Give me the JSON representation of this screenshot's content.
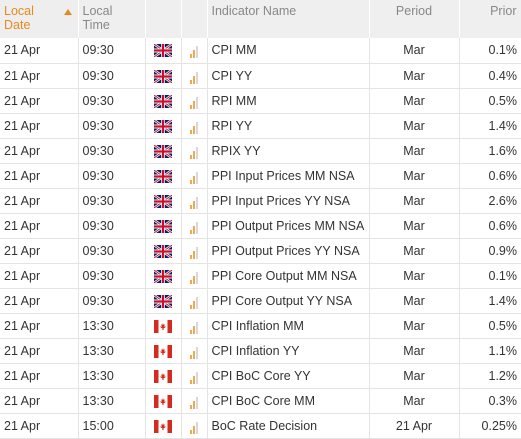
{
  "header": {
    "date": [
      "Local",
      "Date"
    ],
    "time": [
      "Local",
      "Time"
    ],
    "indicator": "Indicator Name",
    "period": "Period",
    "prior": "Prior"
  },
  "colors": {
    "accent": "#e8891d",
    "bar_active": "#f0a94e",
    "bar_inactive": "#d8d8d8"
  },
  "rows": [
    {
      "date": "21 Apr",
      "time": "09:30",
      "flag": "uk-flag",
      "importance": 2,
      "name": "CPI MM",
      "period": "Mar",
      "prior": "0.1%"
    },
    {
      "date": "21 Apr",
      "time": "09:30",
      "flag": "uk-flag",
      "importance": 2,
      "name": "CPI YY",
      "period": "Mar",
      "prior": "0.4%"
    },
    {
      "date": "21 Apr",
      "time": "09:30",
      "flag": "uk-flag",
      "importance": 2,
      "name": "RPI MM",
      "period": "Mar",
      "prior": "0.5%"
    },
    {
      "date": "21 Apr",
      "time": "09:30",
      "flag": "uk-flag",
      "importance": 2,
      "name": "RPI YY",
      "period": "Mar",
      "prior": "1.4%"
    },
    {
      "date": "21 Apr",
      "time": "09:30",
      "flag": "uk-flag",
      "importance": 2,
      "name": "RPIX YY",
      "period": "Mar",
      "prior": "1.6%"
    },
    {
      "date": "21 Apr",
      "time": "09:30",
      "flag": "uk-flag",
      "importance": 2,
      "name": "PPI Input Prices MM NSA",
      "period": "Mar",
      "prior": "0.6%"
    },
    {
      "date": "21 Apr",
      "time": "09:30",
      "flag": "uk-flag",
      "importance": 2,
      "name": "PPI Input Prices YY NSA",
      "period": "Mar",
      "prior": "2.6%"
    },
    {
      "date": "21 Apr",
      "time": "09:30",
      "flag": "uk-flag",
      "importance": 2,
      "name": "PPI Output Prices MM NSA",
      "period": "Mar",
      "prior": "0.6%"
    },
    {
      "date": "21 Apr",
      "time": "09:30",
      "flag": "uk-flag",
      "importance": 2,
      "name": "PPI Output Prices YY NSA",
      "period": "Mar",
      "prior": "0.9%"
    },
    {
      "date": "21 Apr",
      "time": "09:30",
      "flag": "uk-flag",
      "importance": 2,
      "name": "PPI Core Output MM NSA",
      "period": "Mar",
      "prior": "0.1%"
    },
    {
      "date": "21 Apr",
      "time": "09:30",
      "flag": "uk-flag",
      "importance": 2,
      "name": "PPI Core Output YY NSA",
      "period": "Mar",
      "prior": "1.4%"
    },
    {
      "date": "21 Apr",
      "time": "13:30",
      "flag": "canada-flag",
      "importance": 2,
      "name": "CPI Inflation MM",
      "period": "Mar",
      "prior": "0.5%"
    },
    {
      "date": "21 Apr",
      "time": "13:30",
      "flag": "canada-flag",
      "importance": 2,
      "name": "CPI Inflation YY",
      "period": "Mar",
      "prior": "1.1%"
    },
    {
      "date": "21 Apr",
      "time": "13:30",
      "flag": "canada-flag",
      "importance": 2,
      "name": "CPI BoC Core YY",
      "period": "Mar",
      "prior": "1.2%"
    },
    {
      "date": "21 Apr",
      "time": "13:30",
      "flag": "canada-flag",
      "importance": 2,
      "name": "CPI BoC Core MM",
      "period": "Mar",
      "prior": "0.3%"
    },
    {
      "date": "21 Apr",
      "time": "15:00",
      "flag": "canada-flag",
      "importance": 2,
      "name": "BoC Rate Decision",
      "period": "21 Apr",
      "prior": "0.25%"
    }
  ]
}
